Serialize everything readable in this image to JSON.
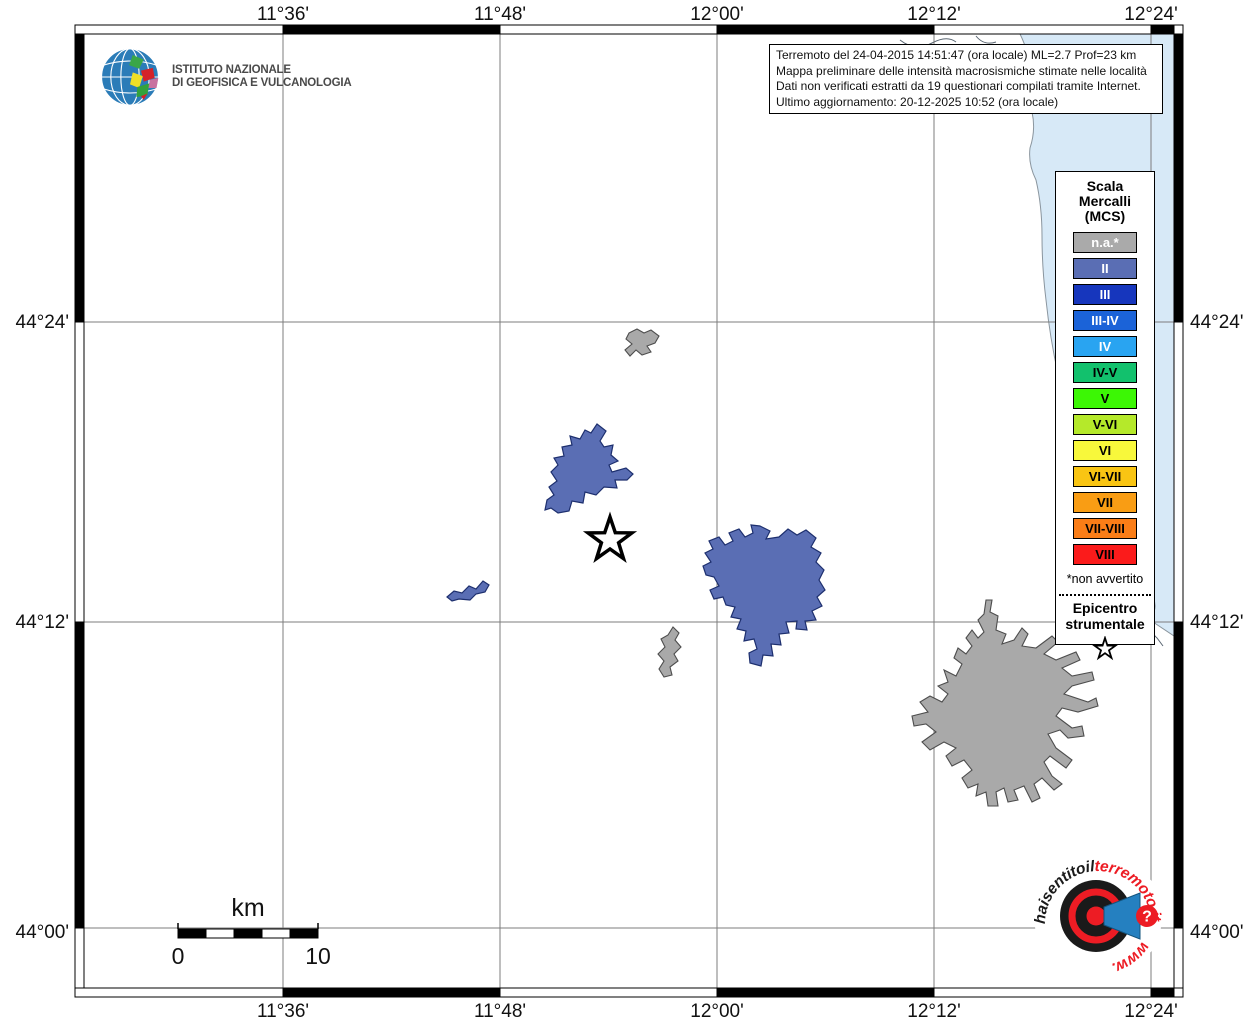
{
  "info_box": {
    "lines": [
      "Terremoto del 24-04-2015 14:51:47 (ora locale) ML=2.7 Prof=23 km",
      "Mappa preliminare delle intensità macrosismiche stimate nelle località",
      "Dati non verificati estratti da 19 questionari compilati tramite Internet.",
      "Ultimo aggiornamento: 20-12-2025 10:52 (ora locale)"
    ]
  },
  "ingv_logo": {
    "line1": "ISTITUTO NAZIONALE",
    "line2": "DI GEOFISICA E VULCANOLOGIA"
  },
  "legend": {
    "title_lines": [
      "Scala",
      "Mercalli",
      "(MCS)"
    ],
    "entries": [
      {
        "label": "n.a.*",
        "color": "#aaaaaa",
        "text_color": "#ffffff"
      },
      {
        "label": "II",
        "color": "#5a6eb4",
        "text_color": "#ffffff"
      },
      {
        "label": "III",
        "color": "#1636bd",
        "text_color": "#ffffff"
      },
      {
        "label": "III-IV",
        "color": "#1b63d8",
        "text_color": "#ffffff"
      },
      {
        "label": "IV",
        "color": "#29a4f1",
        "text_color": "#ffffff"
      },
      {
        "label": "IV-V",
        "color": "#12c16d",
        "text_color": "#000000"
      },
      {
        "label": "V",
        "color": "#3cf705",
        "text_color": "#000000"
      },
      {
        "label": "V-VI",
        "color": "#b5e92a",
        "text_color": "#000000"
      },
      {
        "label": "VI",
        "color": "#f8f83b",
        "text_color": "#000000"
      },
      {
        "label": "VI-VII",
        "color": "#f9c513",
        "text_color": "#000000"
      },
      {
        "label": "VII",
        "color": "#f99d14",
        "text_color": "#000000"
      },
      {
        "label": "VII-VIII",
        "color": "#fa7d17",
        "text_color": "#000000"
      },
      {
        "label": "VIII",
        "color": "#fb1b1b",
        "text_color": "#000000"
      }
    ],
    "footnote": "*non avvertito",
    "epicenter_label_lines": [
      "Epicentro",
      "strumentale"
    ]
  },
  "axes": {
    "top_labels": [
      "11°36'",
      "11°48'",
      "12°00'",
      "12°12'",
      "12°24'"
    ],
    "bottom_labels": [
      "11°36'",
      "11°48'",
      "12°00'",
      "12°12'",
      "12°24'"
    ],
    "left_labels": [
      "44°24'",
      "44°12'",
      "44°00'"
    ],
    "right_labels": [
      "44°24'",
      "44°12'",
      "44°00'"
    ]
  },
  "scale_bar": {
    "unit_label": "km",
    "start_label": "0",
    "end_label": "10"
  },
  "watermark": {
    "arc_black": "haisentitoil",
    "arc_red": "terremoto.it",
    "bottom_red": "www.",
    "badge": "?"
  },
  "map": {
    "epicenter_symbol": "star",
    "locality_intensities": [
      "II",
      "II",
      "II",
      "n.a.",
      "n.a.",
      "n.a."
    ]
  },
  "colors": {
    "sea": "#d7e9f7",
    "land": "#ffffff",
    "grid": "#7c7c7c",
    "coast": "#5a6672",
    "intensity_ii": "#5a6eb4",
    "intensity_ii_stroke": "#1d2f6e",
    "intensity_na": "#a9a9a9",
    "intensity_na_stroke": "#4d4d4d",
    "logo_red": "#ed1c24",
    "logo_blue": "#2580c0"
  }
}
